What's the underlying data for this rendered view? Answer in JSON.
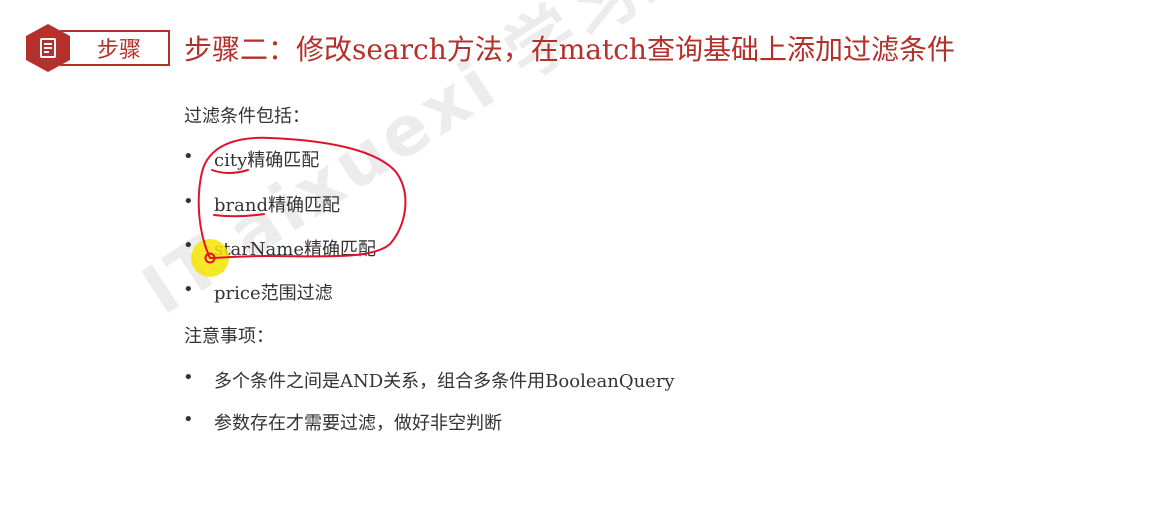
{
  "watermark": "IT-aixuexi 学习正版课程+v: IT-aixuexi",
  "badge": {
    "label": "步骤"
  },
  "title": "步骤二：修改search方法，在match查询基础上添加过滤条件",
  "filters": {
    "heading": "过滤条件包括：",
    "items": [
      "city精确匹配",
      "brand精确匹配",
      "starName精确匹配",
      "price范围过滤"
    ]
  },
  "notes": {
    "heading": "注意事项：",
    "items": [
      "多个条件之间是AND关系，组合多条件用BooleanQuery",
      "参数存在才需要过滤，做好非空判断"
    ]
  },
  "bullet": "•",
  "colors": {
    "accent": "#b4302a",
    "annotation": "#e0112a",
    "highlight": "#f5e400"
  }
}
